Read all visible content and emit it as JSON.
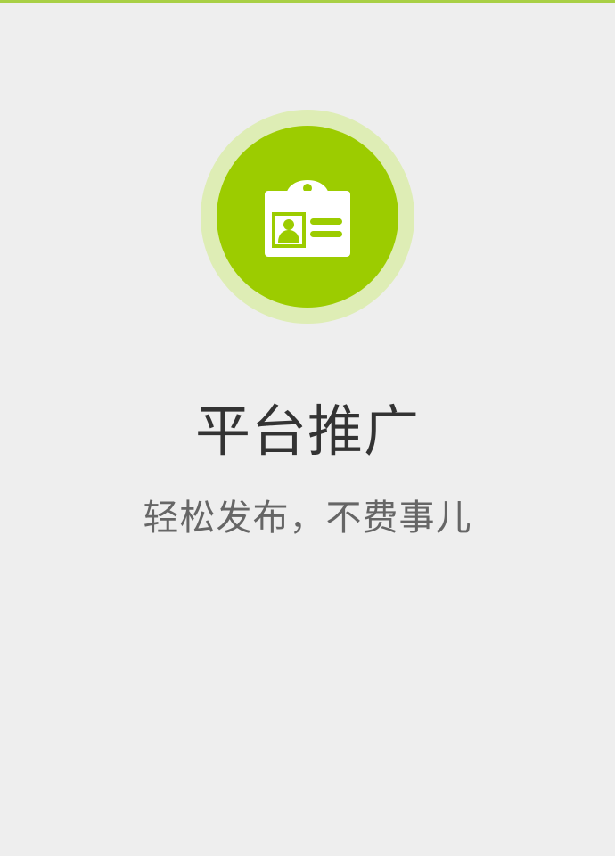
{
  "colors": {
    "accent": "#9ccc00",
    "accent_halo": "#deedb5",
    "top_bar": "#a8cf45",
    "background": "#eeeeee"
  },
  "hero": {
    "icon": "id-badge-icon",
    "title": "平台推广",
    "subtitle": "轻松发布，不费事儿"
  }
}
